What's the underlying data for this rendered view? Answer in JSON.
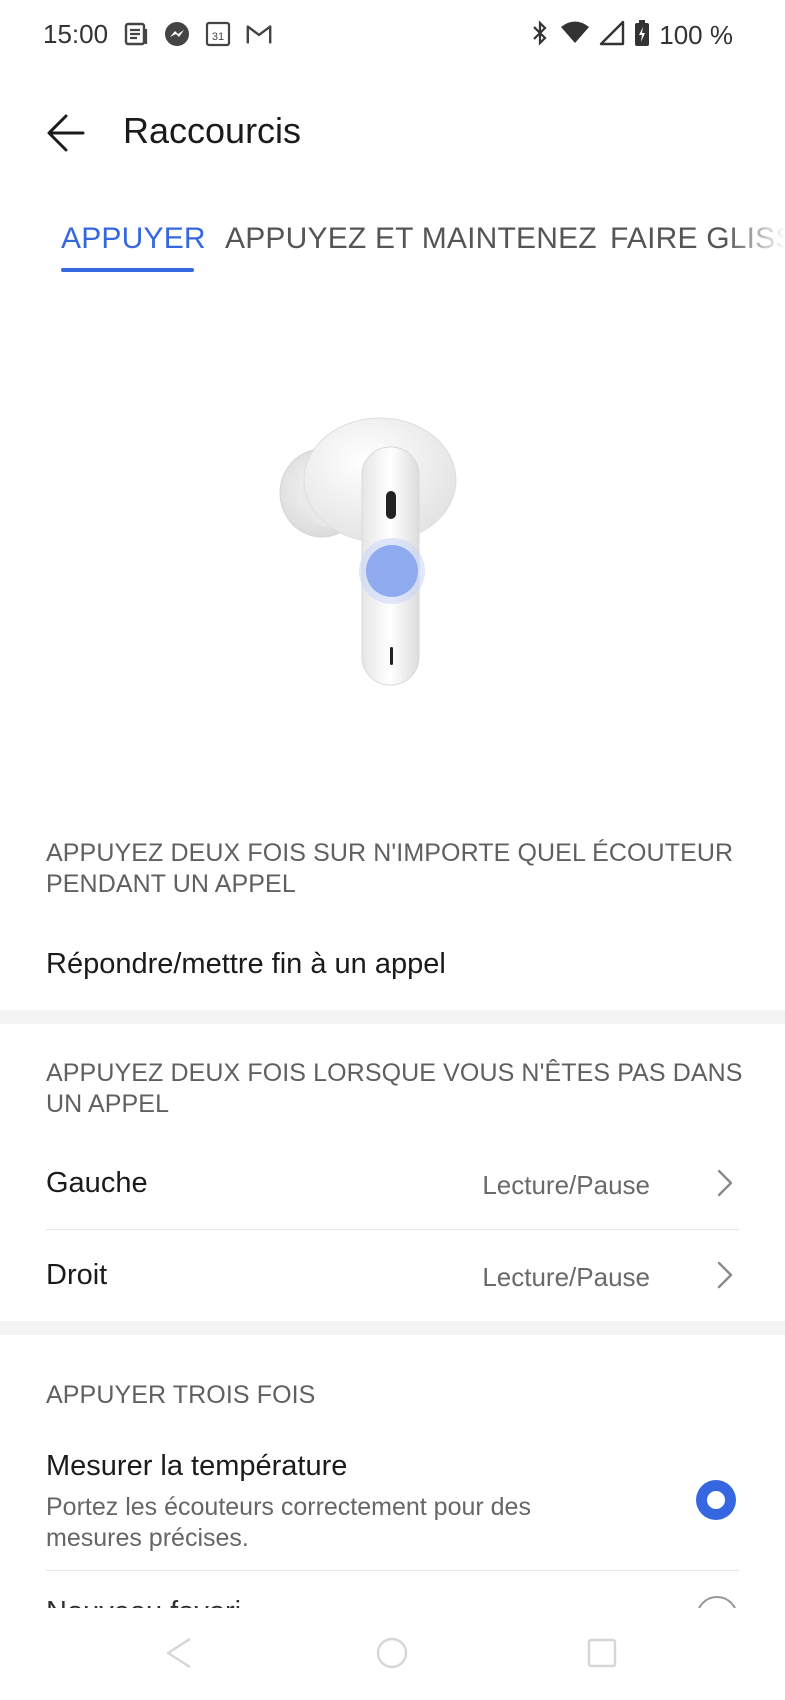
{
  "status_bar": {
    "time": "15:00",
    "left_icons": [
      "news-icon",
      "messenger-icon",
      "calendar-icon",
      "gmail-icon"
    ],
    "calendar_day": "31",
    "right_icons": [
      "bluetooth-icon",
      "wifi-icon",
      "signal-icon",
      "battery-charging-icon"
    ],
    "battery": "100 %"
  },
  "app_bar": {
    "title": "Raccourcis",
    "back_icon": "arrow-back-icon"
  },
  "tabs": {
    "items": [
      {
        "label": "APPUYER",
        "active": true
      },
      {
        "label": "APPUYEZ ET MAINTENEZ",
        "active": false
      },
      {
        "label": "FAIRE GLISSER",
        "active": false
      }
    ],
    "accent": "#3567e0"
  },
  "section_call": {
    "header": "APPUYEZ DEUX FOIS SUR N'IMPORTE QUEL ÉCOUTEUR PENDANT UN APPEL",
    "row": "Répondre/mettre fin à un appel"
  },
  "section_no_call": {
    "header": "APPUYEZ DEUX FOIS LORSQUE VOUS N'ÊTES PAS DANS UN APPEL",
    "rows": [
      {
        "label": "Gauche",
        "value": "Lecture/Pause"
      },
      {
        "label": "Droit",
        "value": "Lecture/Pause"
      }
    ]
  },
  "section_triple": {
    "header": "APPUYER TROIS FOIS",
    "options": [
      {
        "label": "Mesurer la température",
        "sub": "Portez les écouteurs correctement pour des mesures précises.",
        "selected": true
      },
      {
        "label": "Nouveau favori",
        "selected": false
      }
    ]
  },
  "nav_bar": {
    "icons": [
      "back-triangle-icon",
      "home-circle-icon",
      "recents-square-icon"
    ]
  }
}
